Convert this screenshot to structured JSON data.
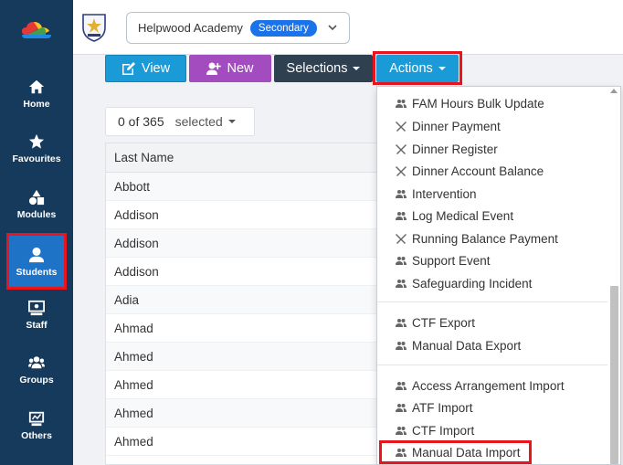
{
  "sidebar": {
    "items": [
      {
        "label": "Home",
        "icon": "home-icon"
      },
      {
        "label": "Favourites",
        "icon": "star-icon"
      },
      {
        "label": "Modules",
        "icon": "shapes-icon"
      },
      {
        "label": "Students",
        "icon": "user-icon"
      },
      {
        "label": "Staff",
        "icon": "staff-icon"
      },
      {
        "label": "Groups",
        "icon": "groups-icon"
      },
      {
        "label": "Others",
        "icon": "others-icon"
      }
    ]
  },
  "header": {
    "school_name": "Helpwood Academy",
    "school_phase": "Secondary"
  },
  "toolbar": {
    "view_label": "View",
    "new_label": "New",
    "selections_label": "Selections",
    "actions_label": "Actions"
  },
  "selection": {
    "count": "0 of 365",
    "label": "selected"
  },
  "table": {
    "header": "Last Name",
    "rows": [
      "Abbott",
      "Addison",
      "Addison",
      "Addison",
      "Adia",
      "Ahmad",
      "Ahmed",
      "Ahmed",
      "Ahmed",
      "Ahmed"
    ]
  },
  "actions_menu": {
    "group1": [
      {
        "label": "FAM Hours Bulk Update",
        "icon": "people-icon"
      },
      {
        "label": "Dinner Payment",
        "icon": "cutlery-icon"
      },
      {
        "label": "Dinner Register",
        "icon": "cutlery-icon"
      },
      {
        "label": "Dinner Account Balance",
        "icon": "cutlery-icon"
      },
      {
        "label": "Intervention",
        "icon": "people-icon"
      },
      {
        "label": "Log Medical Event",
        "icon": "people-icon"
      },
      {
        "label": "Running Balance Payment",
        "icon": "cutlery-icon"
      },
      {
        "label": "Support Event",
        "icon": "people-icon"
      },
      {
        "label": "Safeguarding Incident",
        "icon": "people-icon"
      }
    ],
    "group2": [
      {
        "label": "CTF Export",
        "icon": "people-icon"
      },
      {
        "label": "Manual Data Export",
        "icon": "people-icon"
      }
    ],
    "group3": [
      {
        "label": "Access Arrangement Import",
        "icon": "people-icon"
      },
      {
        "label": "ATF Import",
        "icon": "people-icon"
      },
      {
        "label": "CTF Import",
        "icon": "people-icon"
      },
      {
        "label": "Manual Data Import",
        "icon": "people-icon"
      }
    ]
  },
  "colors": {
    "sidebar_bg": "#163a5c",
    "active_nav": "#1f73c7",
    "highlight": "#e8141e",
    "view_button": "#1a9ad6",
    "new_button": "#a24cc0",
    "selections_button": "#2f4050",
    "actions_button": "#1a9ad6",
    "badge": "#1a73e8"
  }
}
